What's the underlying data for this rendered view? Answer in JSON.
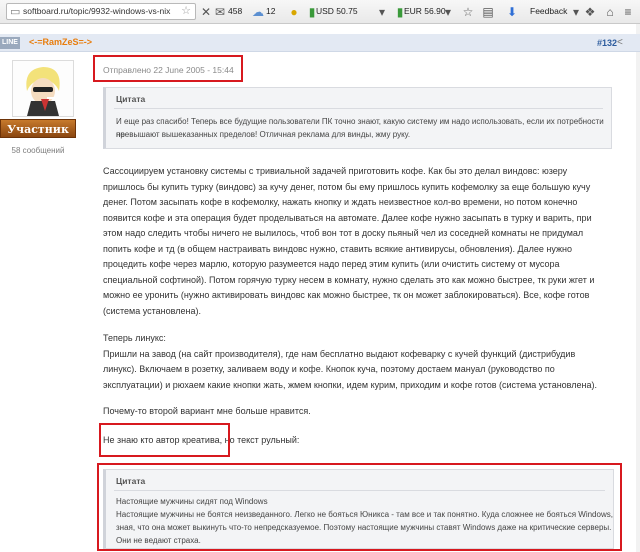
{
  "browser": {
    "url": "softboard.ru/topic/9932-windows-vs-nix",
    "weather_count": "458",
    "weather2": "12",
    "usd": "USD 50.75",
    "eur": "EUR 56.90",
    "feedback": "Feedback"
  },
  "post": {
    "status_label": "LINE",
    "author": "<-=RamZeS=->",
    "number": "#132",
    "date": "Отправлено 22 June 2005 - 15:44",
    "rank": "Участник",
    "message_count": "58 сообщений",
    "quote1": {
      "title": "Цитата",
      "lines": [
        "И еще раз спасибо! Теперь все будущие пользователи ПК точно знают, какую систему им надо использовать, если их потребности не",
        "превышают вышеказанных пределов! Отличная реклама для винды, жму руку."
      ]
    },
    "para1": [
      "Сассоциируем установку системы с тривиальной задачей приготовить кофе. Как бы это делал виндовс: юзеру",
      "пришлось бы купить турку (виндовс) за кучу денег, потом бы ему пришлось купить кофемолку за еще большую кучу",
      "денег. Потом засыпать кофе в кофемолку, нажать кнопку и ждать неизвестное кол-во времени, но потом конечно",
      "появится кофе и эта операция будет проделываться на автомате. Далее кофе нужно засыпать в турку и варить, при",
      "этом надо следить чтобы ничего не вылилось, чтоб вон тот в доску пьяный чел из соседней комнаты не придумал",
      "попить кофе и тд (в общем настраивать виндовс нужно, ставить всякие антивирусы, обновления). Далее нужно",
      "процедить кофе через марлю, которую разумеется надо перед этим купить (или очистить систему от мусора",
      "специальной софтиной). Потом горячую турку несем в комнату, нужно сделать это как можно быстрее, тк руки жгет и",
      "можно ее уронить (нужно активировать виндовс как можно быстрее, тк он может заблокироваться). Все, кофе готов",
      "(система установлена)."
    ],
    "para2": [
      "Теперь линукс:",
      "Пришли на завод (на сайт производителя), где нам бесплатно выдают кофеварку с кучей функций (дистрибудив",
      "линукс). Включаем в розетку, заливаем воду и кофе. Кнопок куча, поэтому достаем мануал (руководство по",
      "эксплуатации) и рюхаем какие кнопки жать, жмем кнопки, идем курим, приходим и кофе готов (система установлена)."
    ],
    "para3": "Почему-то второй вариант мне больше нравится.",
    "para4_part1": "Не знаю кто автор креатива",
    "para4_part2": ", но текст рульный:",
    "quote2": {
      "title": "Цитата",
      "lines": [
        "Настоящие мужчины сидят под Windows",
        "Настоящие мужчины не боятся неизведанного. Легко не бояться Юникса - там все и так понятно. Куда сложнее не бояться Windows,",
        "зная, что она может выкинуть что-то непредсказуемое. Поэтому настоящие мужчины ставят Windows даже на критические серверы.",
        "Они не ведают страха."
      ]
    }
  },
  "colors": {
    "accent_orange": "#e87d0d",
    "link_blue": "#2d5c9e",
    "highlight_red": "#d7191f",
    "rank_brown": "#a65a1a"
  }
}
